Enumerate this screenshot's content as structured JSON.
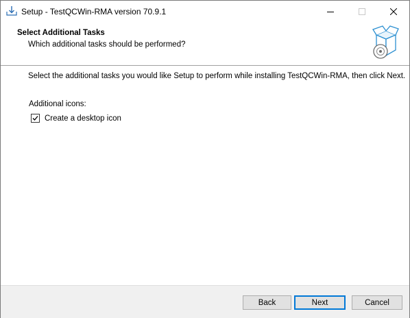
{
  "window": {
    "title": "Setup - TestQCWin-RMA version 70.9.1"
  },
  "header": {
    "title": "Select Additional Tasks",
    "subtitle": "Which additional tasks should be performed?"
  },
  "main": {
    "instruction": "Select the additional tasks you would like Setup to perform while installing TestQCWin-RMA, then click Next.",
    "group_label": "Additional icons:",
    "tasks": [
      {
        "label": "Create a desktop icon",
        "checked": true
      }
    ]
  },
  "buttons": {
    "back": "Back",
    "next": "Next",
    "cancel": "Cancel"
  },
  "colors": {
    "accent": "#0078d7",
    "footer_bg": "#f0f0f0",
    "button_bg": "#e1e1e1"
  }
}
